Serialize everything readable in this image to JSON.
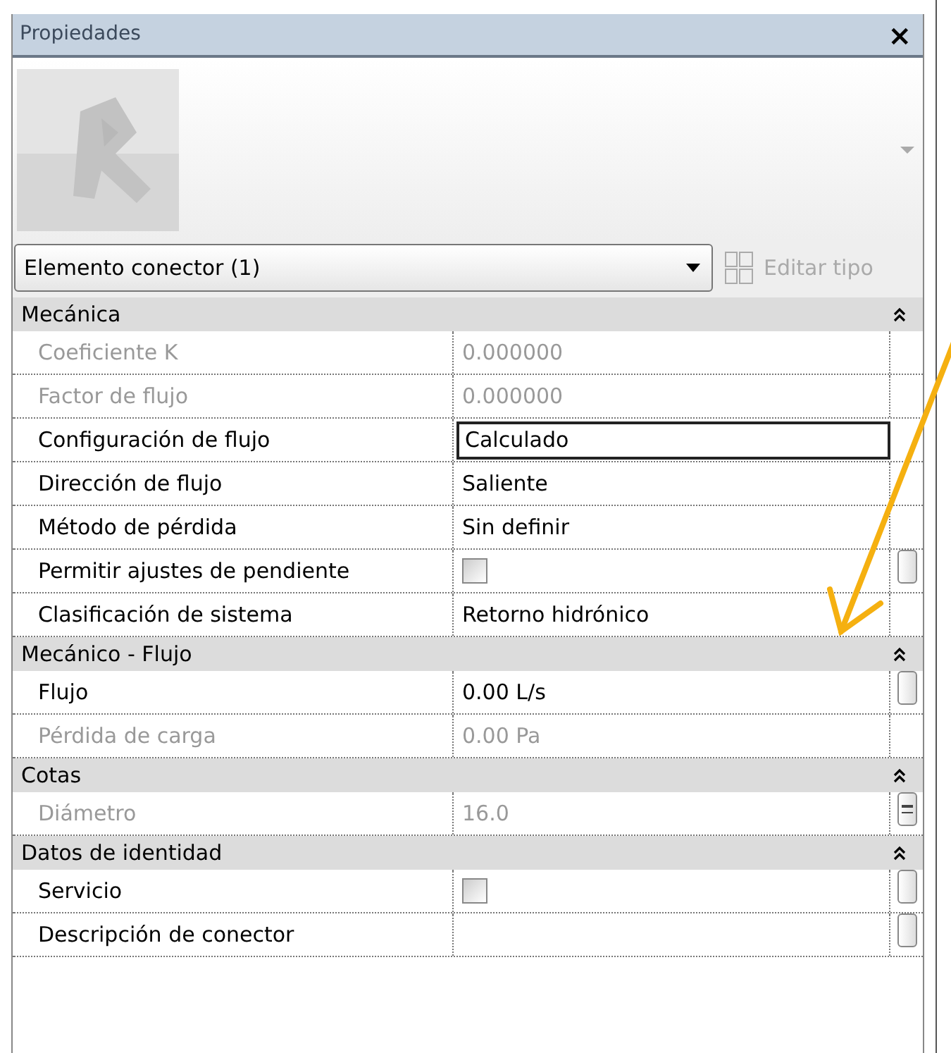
{
  "title": "Propiedades",
  "close": "×",
  "type_selector": {
    "value": "Elemento conector (1)"
  },
  "edit_type": {
    "label": "Editar tipo",
    "disabled": true
  },
  "groups": [
    {
      "name": "Mecánica",
      "expanded": true,
      "rows": [
        {
          "label": "Coeficiente K",
          "kind": "text",
          "value": "0.000000",
          "disabled": true,
          "focused": false
        },
        {
          "label": "Factor de flujo",
          "kind": "text",
          "value": "0.000000",
          "disabled": true,
          "focused": false
        },
        {
          "label": "Configuración de flujo",
          "kind": "text",
          "value": "Calculado",
          "disabled": false,
          "focused": true
        },
        {
          "label": "Dirección de flujo",
          "kind": "text",
          "value": "Saliente",
          "disabled": false,
          "focused": false
        },
        {
          "label": "Método de pérdida",
          "kind": "text",
          "value": "Sin definir",
          "disabled": false,
          "focused": false
        },
        {
          "label": "Permitir ajustes de pendiente",
          "kind": "checkbox",
          "checked": false,
          "disabled": false,
          "focused": false,
          "side_button": true,
          "formula": false
        },
        {
          "label": "Clasificación de sistema",
          "kind": "text",
          "value": "Retorno hidrónico",
          "disabled": false,
          "focused": false
        }
      ]
    },
    {
      "name": "Mecánico - Flujo",
      "expanded": true,
      "rows": [
        {
          "label": "Flujo",
          "kind": "text",
          "value": "0.00 L/s",
          "disabled": false,
          "focused": false,
          "side_button": true,
          "formula": false
        },
        {
          "label": "Pérdida de carga",
          "kind": "text",
          "value": "0.00 Pa",
          "disabled": true,
          "focused": false
        }
      ]
    },
    {
      "name": "Cotas",
      "expanded": true,
      "rows": [
        {
          "label": "Diámetro",
          "kind": "text",
          "value": "16.0",
          "disabled": true,
          "focused": false,
          "side_button": true,
          "formula": true
        }
      ]
    },
    {
      "name": "Datos de identidad",
      "expanded": true,
      "rows": [
        {
          "label": "Servicio",
          "kind": "checkbox",
          "checked": false,
          "disabled": false,
          "focused": false,
          "side_button": true,
          "formula": false
        },
        {
          "label": "Descripción de conector",
          "kind": "text",
          "disabled": false,
          "focused": false,
          "side_button": true,
          "formula": false
        }
      ]
    }
  ],
  "annotation": {
    "kind": "arrow"
  }
}
